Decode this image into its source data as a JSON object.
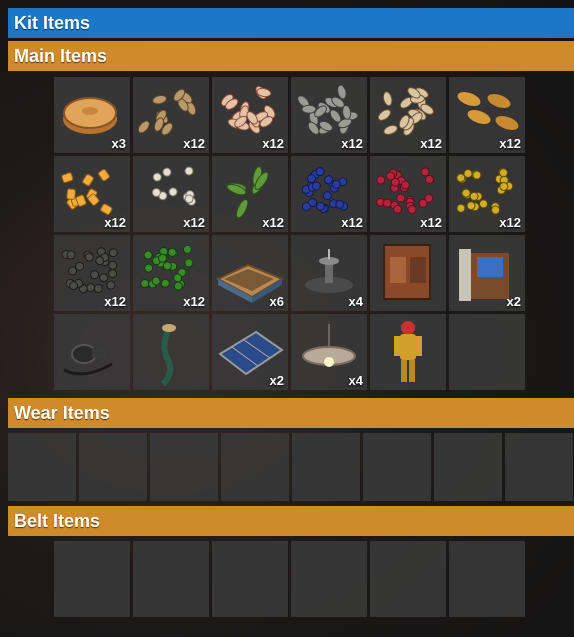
{
  "sections": {
    "kit_title": "Kit Items",
    "main_title": "Main Items",
    "wear_title": "Wear Items",
    "belt_title": "Belt Items"
  },
  "main_items": [
    {
      "icon": "pie-icon",
      "qty": "x3"
    },
    {
      "icon": "wheat-seed-icon",
      "qty": "x12"
    },
    {
      "icon": "rose-seeds-icon",
      "qty": "x12"
    },
    {
      "icon": "sunflower-seeds-icon",
      "qty": "x12"
    },
    {
      "icon": "potato-seeds-icon",
      "qty": "x12"
    },
    {
      "icon": "pumpkin-seeds-icon",
      "qty": "x12"
    },
    {
      "icon": "corn-seeds-icon",
      "qty": "x12"
    },
    {
      "icon": "white-berry-seeds-icon",
      "qty": "x12"
    },
    {
      "icon": "hemp-seeds-icon",
      "qty": "x12"
    },
    {
      "icon": "blue-berry-seeds-icon",
      "qty": "x12"
    },
    {
      "icon": "red-berry-seeds-icon",
      "qty": "x12"
    },
    {
      "icon": "yellow-berry-seeds-icon",
      "qty": "x12"
    },
    {
      "icon": "black-berry-seeds-icon",
      "qty": "x12"
    },
    {
      "icon": "green-berry-seeds-icon",
      "qty": "x12"
    },
    {
      "icon": "planter-box-icon",
      "qty": "x6"
    },
    {
      "icon": "sprinkler-icon",
      "qty": "x4"
    },
    {
      "icon": "water-barrel-icon",
      "qty": ""
    },
    {
      "icon": "fluid-pump-icon",
      "qty": "x2"
    },
    {
      "icon": "hose-tool-icon",
      "qty": ""
    },
    {
      "icon": "garden-hose-icon",
      "qty": ""
    },
    {
      "icon": "solar-panel-icon",
      "qty": "x2"
    },
    {
      "icon": "ceiling-light-icon",
      "qty": "x4"
    },
    {
      "icon": "hazmat-suit-icon",
      "qty": ""
    },
    {
      "icon": "empty-slot-icon",
      "qty": ""
    }
  ],
  "colors": {
    "kit_header": "#1b78c8",
    "section_header": "#cf8a2a",
    "slot": "#3a3a3a"
  }
}
